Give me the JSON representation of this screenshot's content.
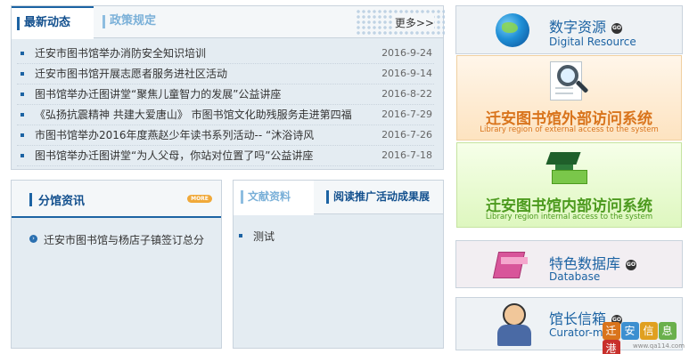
{
  "news": {
    "tabs": [
      "最新动态",
      "政策规定"
    ],
    "more": "更多>>",
    "items": [
      {
        "title": "迁安市图书馆举办消防安全知识培训",
        "date": "2016-9-24"
      },
      {
        "title": "迁安市图书馆开展志愿者服务进社区活动",
        "date": "2016-9-14"
      },
      {
        "title": "图书馆举办迁图讲堂“聚焦儿童智力的发展”公益讲座",
        "date": "2016-8-22"
      },
      {
        "title": "《弘扬抗震精神 共建大爱唐山》 市图书馆文化助残服务走进第四福",
        "date": "2016-7-29"
      },
      {
        "title": "市图书馆举办2016年度燕赵少年读书系列活动-- “沐浴诗风",
        "date": "2016-7-26"
      },
      {
        "title": "图书馆举办迁图讲堂“为人父母，你站对位置了吗”公益讲座",
        "date": "2016-7-18"
      }
    ]
  },
  "branch": {
    "title": "分馆资讯",
    "more_badge": "MORE",
    "item_icon": "›",
    "item": "迁安市图书馆与杨店子镇签订总分"
  },
  "docs": {
    "tabs": [
      "文献资料",
      "阅读推广活动成果展"
    ],
    "item": "测试"
  },
  "resources": {
    "digital": {
      "cn": "数字资源",
      "en": "Digital Resource"
    },
    "go": "GO",
    "external": {
      "cn": "迁安图书馆外部访问系统",
      "en": "Library  region of external access to the system"
    },
    "internal": {
      "cn": "迁安图书馆内部访问系统",
      "en": "Library  region internal access to the system"
    },
    "special": {
      "cn": "特色数据库",
      "en": "Database"
    },
    "curator": {
      "cn": "馆长信箱",
      "en": "Curator-mail"
    }
  },
  "watermark": {
    "chars": [
      "迁",
      "安",
      "信",
      "息",
      "港"
    ],
    "url": "www.qa114.com"
  },
  "colors": {
    "primary": "#1c63a3",
    "external": "#d9741c",
    "internal": "#4c9a1e",
    "watermark": [
      "#d9741c",
      "#3c8fd0",
      "#e0a020",
      "#6ab04c",
      "#c8302c"
    ]
  }
}
